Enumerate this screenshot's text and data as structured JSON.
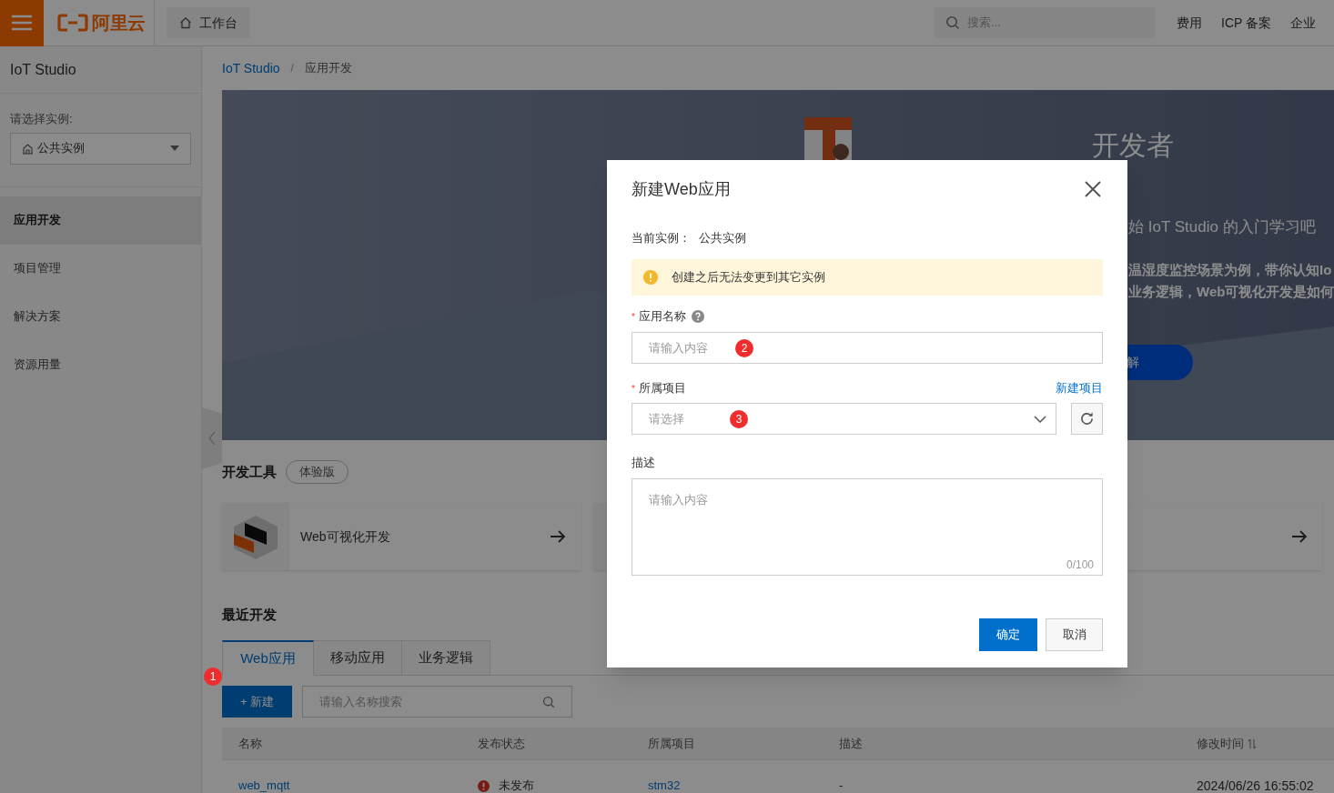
{
  "top_bar": {
    "logo_text": "阿里云",
    "workbench": "工作台",
    "search_placeholder": "搜索...",
    "links": [
      "费用",
      "ICP 备案",
      "企业"
    ]
  },
  "sidebar": {
    "title": "IoT Studio",
    "instance_label": "请选择实例:",
    "instance_value": "公共实例",
    "items": [
      {
        "label": "应用开发",
        "selected": true
      },
      {
        "label": "项目管理",
        "selected": false
      },
      {
        "label": "解决方案",
        "selected": false
      },
      {
        "label": "资源用量",
        "selected": false
      }
    ]
  },
  "breadcrumb": {
    "items": [
      "IoT Studio",
      "应用开发"
    ],
    "separator": "/"
  },
  "banner": {
    "heading": "开发者",
    "subtitle": "始 IoT Studio 的入门学习吧",
    "description_lines": [
      "温湿度监控场景为例，带你认知Io",
      "业务逻辑，Web可视化开发是如何"
    ],
    "button": "解"
  },
  "dev_tools": {
    "title": "开发工具",
    "badge": "体验版",
    "cards": [
      {
        "kind": "web",
        "label": "Web可视化开发"
      },
      {
        "kind": "mobile"
      }
    ]
  },
  "recent": {
    "title": "最近开发",
    "tabs": [
      {
        "label": "Web应用",
        "selected": true
      },
      {
        "label": "移动应用",
        "selected": false
      },
      {
        "label": "业务逻辑",
        "selected": false
      }
    ],
    "new_button": "+ 新建",
    "search_placeholder": "请输入名称搜索",
    "columns": [
      "名称",
      "发布状态",
      "所属项目",
      "描述",
      "修改时间"
    ],
    "rows": [
      {
        "name": "web_mqtt",
        "published": false,
        "status": "未发布",
        "project": "stm32",
        "description": "-",
        "modified": "2024/06/26 16:55:02"
      }
    ]
  },
  "modal": {
    "title": "新建Web应用",
    "instance_label": "当前实例：",
    "instance_value": "公共实例",
    "warning": "创建之后无法变更到其它实例",
    "name_field": {
      "label": "应用名称",
      "required": true,
      "placeholder": "请输入内容"
    },
    "project_field": {
      "label": "所属项目",
      "required": true,
      "placeholder": "请选择",
      "action": "新建项目"
    },
    "description_field": {
      "label": "描述",
      "required": false,
      "placeholder": "请输入内容",
      "counter": "0/100"
    },
    "required_mark": "*",
    "ok": "确定",
    "cancel": "取消"
  },
  "step_badges": [
    "1",
    "2",
    "3"
  ]
}
